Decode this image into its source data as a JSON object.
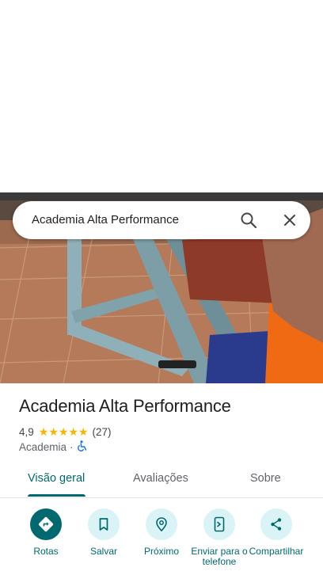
{
  "search": {
    "query": "Academia Alta Performance"
  },
  "place": {
    "title": "Academia Alta Performance",
    "rating": "4,9",
    "stars": "★★★★★",
    "review_count": "(27)",
    "category": "Academia",
    "separator": "·"
  },
  "tabs": [
    {
      "label": "Visão geral",
      "active": true
    },
    {
      "label": "Avaliações",
      "active": false
    },
    {
      "label": "Sobre",
      "active": false
    }
  ],
  "actions": [
    {
      "label": "Rotas",
      "icon": "directions-icon"
    },
    {
      "label": "Salvar",
      "icon": "bookmark-icon"
    },
    {
      "label": "Próximo",
      "icon": "nearby-icon"
    },
    {
      "label": "Enviar para o telefone",
      "icon": "send-to-phone-icon"
    },
    {
      "label": "Compartilhar",
      "icon": "share-icon"
    }
  ],
  "colors": {
    "accent": "#00696f",
    "accent_container": "#d9f3f6",
    "star": "#f5b400",
    "wheelchair": "#1a73e8"
  }
}
